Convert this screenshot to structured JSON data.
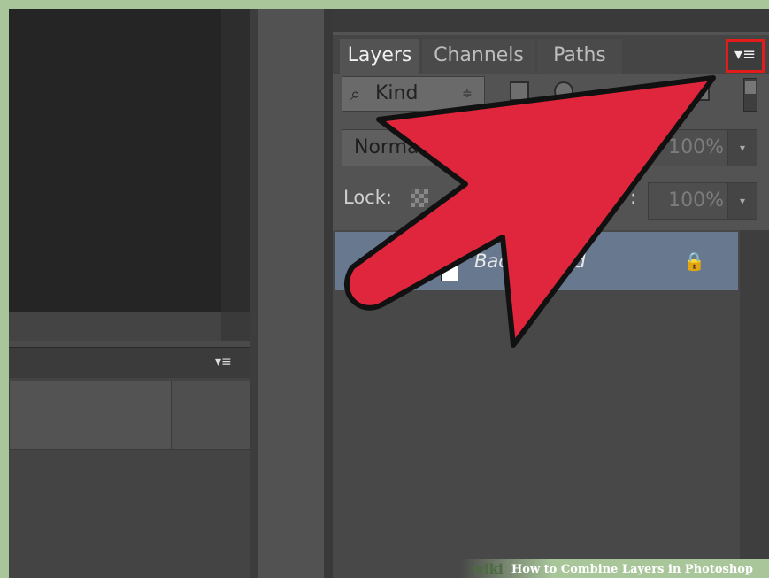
{
  "layers_panel": {
    "tabs": [
      "Layers",
      "Channels",
      "Paths"
    ],
    "menu_glyph": "▾≡",
    "filter": {
      "icon": "⌕",
      "label": "Kind",
      "arrow": "≑"
    },
    "blend_mode": "Normal",
    "opacity": "100%",
    "lock_label": "Lock:",
    "fill_colon": ":",
    "fill": "100%",
    "dropdown_arrow": "▾",
    "layer": {
      "name": "Background",
      "lock_glyph": "🔒"
    }
  },
  "left_panel": {
    "menu_glyph": "▾≡"
  },
  "annotation": {
    "arrow_color": "#e0263c",
    "highlight_color": "#e21b1b"
  },
  "watermark": {
    "brand": "wiki",
    "title": "How to Combine Layers in Photoshop"
  }
}
